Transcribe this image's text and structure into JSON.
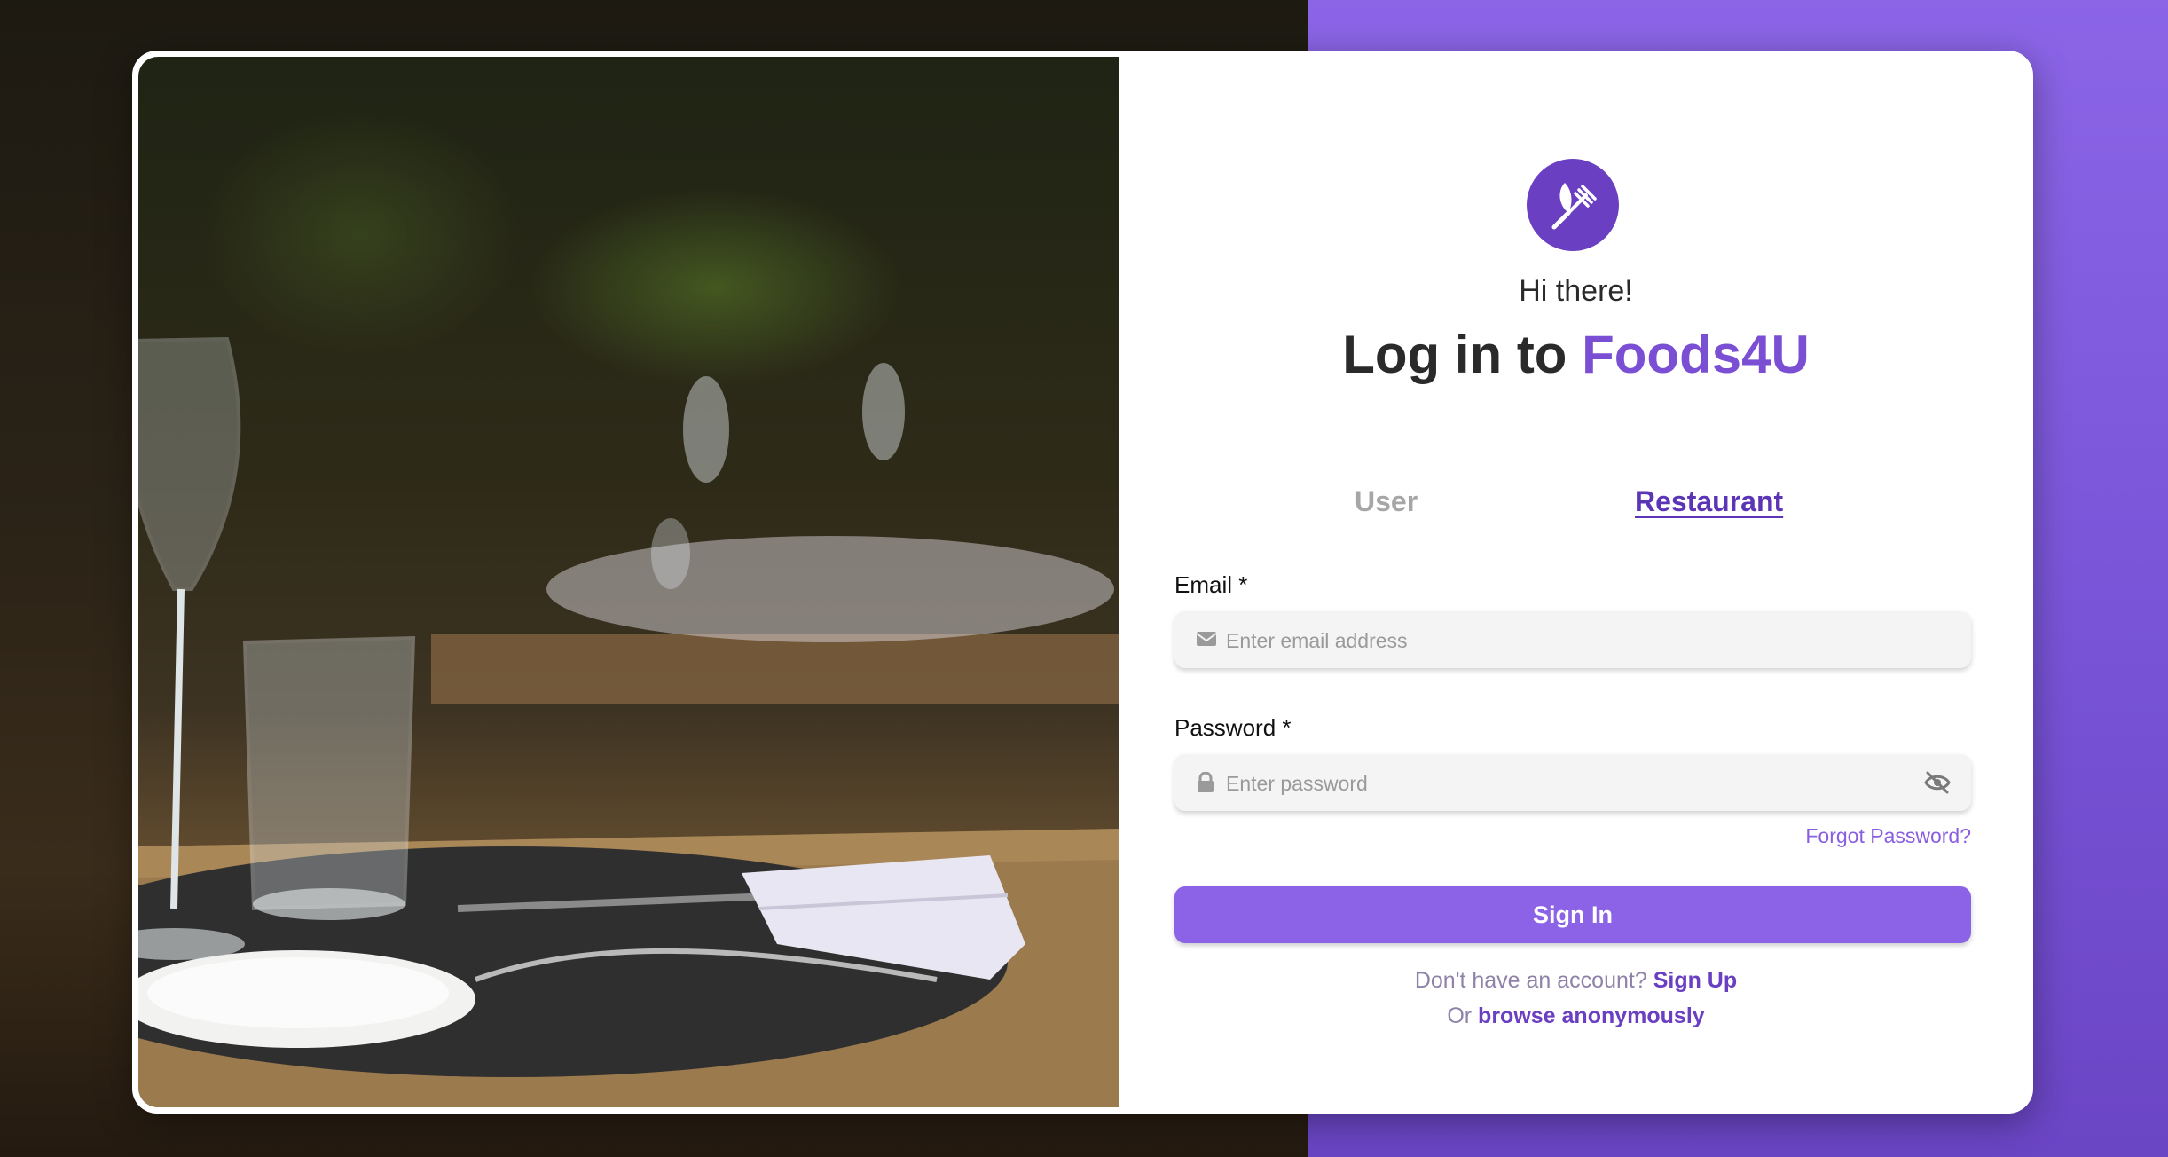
{
  "colors": {
    "accent": "#8c63e6",
    "brand_dark": "#6a3fc2",
    "background_right": "#7a55d8"
  },
  "logo": {
    "icon": "leaf-fork-icon"
  },
  "header": {
    "greeting": "Hi there!",
    "title_prefix": "Log in to ",
    "title_brand": "Foods4U"
  },
  "tabs": {
    "user_label": "User",
    "restaurant_label": "Restaurant",
    "active": "Restaurant"
  },
  "form": {
    "email_label": "Email *",
    "email_placeholder": "Enter email address",
    "email_value": "",
    "password_label": "Password *",
    "password_placeholder": "Enter password",
    "password_value": "",
    "forgot_password": "Forgot Password?",
    "sign_in_label": "Sign In"
  },
  "footer": {
    "signup_prompt": "Don't have an account?",
    "signup_link": "Sign Up",
    "browse_prefix": "Or",
    "browse_link": "browse anonymously"
  }
}
